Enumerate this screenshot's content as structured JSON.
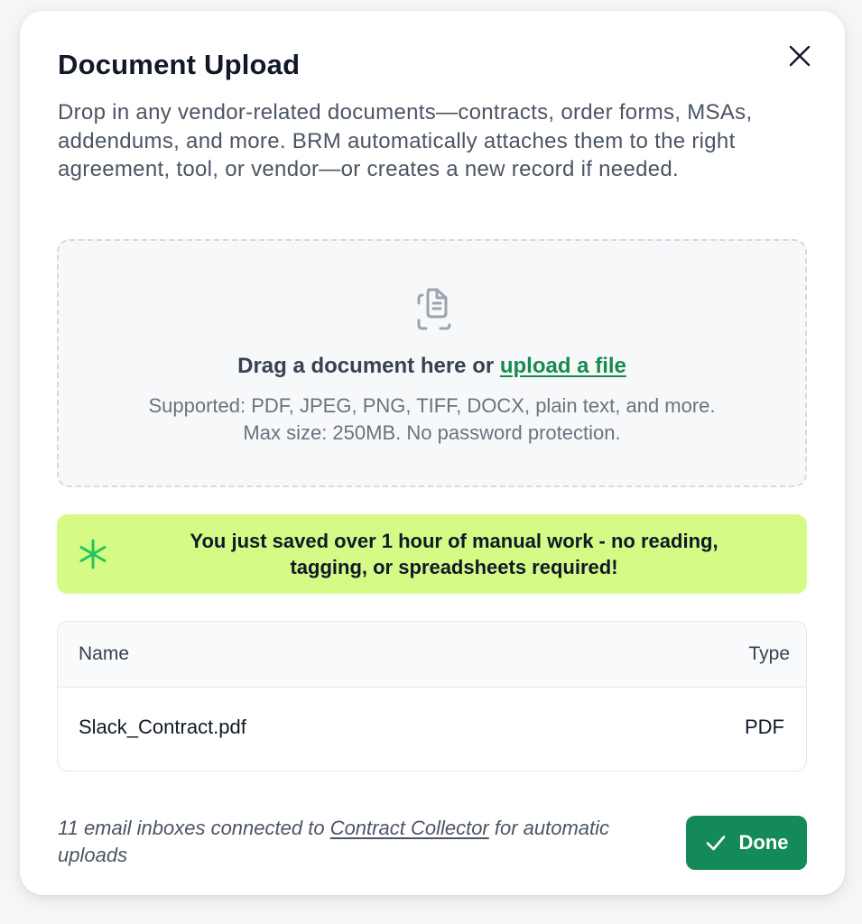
{
  "dialog": {
    "title": "Document Upload",
    "description": "Drop in any vendor-related documents—contracts, order forms, MSAs, addendums, and more. BRM automatically attaches them to the right agreement, tool, or vendor—or creates a new record if needed.",
    "close_icon": "close-icon"
  },
  "dropzone": {
    "icon": "document-scan-icon",
    "heading_prefix": "Drag a document here or ",
    "upload_link": "upload a file",
    "supported": "Supported: PDF, JPEG, PNG, TIFF, DOCX, plain text, and more.",
    "limits": "Max size: 250MB. No password protection."
  },
  "savings_banner": {
    "icon": "sparkle-icon",
    "line1": "You just saved over 1 hour of manual work - no reading,",
    "line2": "tagging, or spreadsheets required!",
    "background": "#d5fb86"
  },
  "files_table": {
    "columns": {
      "name": "Name",
      "type": "Type"
    },
    "rows": [
      {
        "name": "Slack_Contract.pdf",
        "type": "PDF"
      }
    ]
  },
  "footer": {
    "prefix": "11 email inboxes connected to ",
    "link": "Contract Collector",
    "suffix": " for automatic uploads",
    "done_label": "Done",
    "done_icon": "check-icon"
  },
  "colors": {
    "accent_green": "#138a57",
    "link_green": "#178a51",
    "banner_lime": "#d5fb86"
  }
}
